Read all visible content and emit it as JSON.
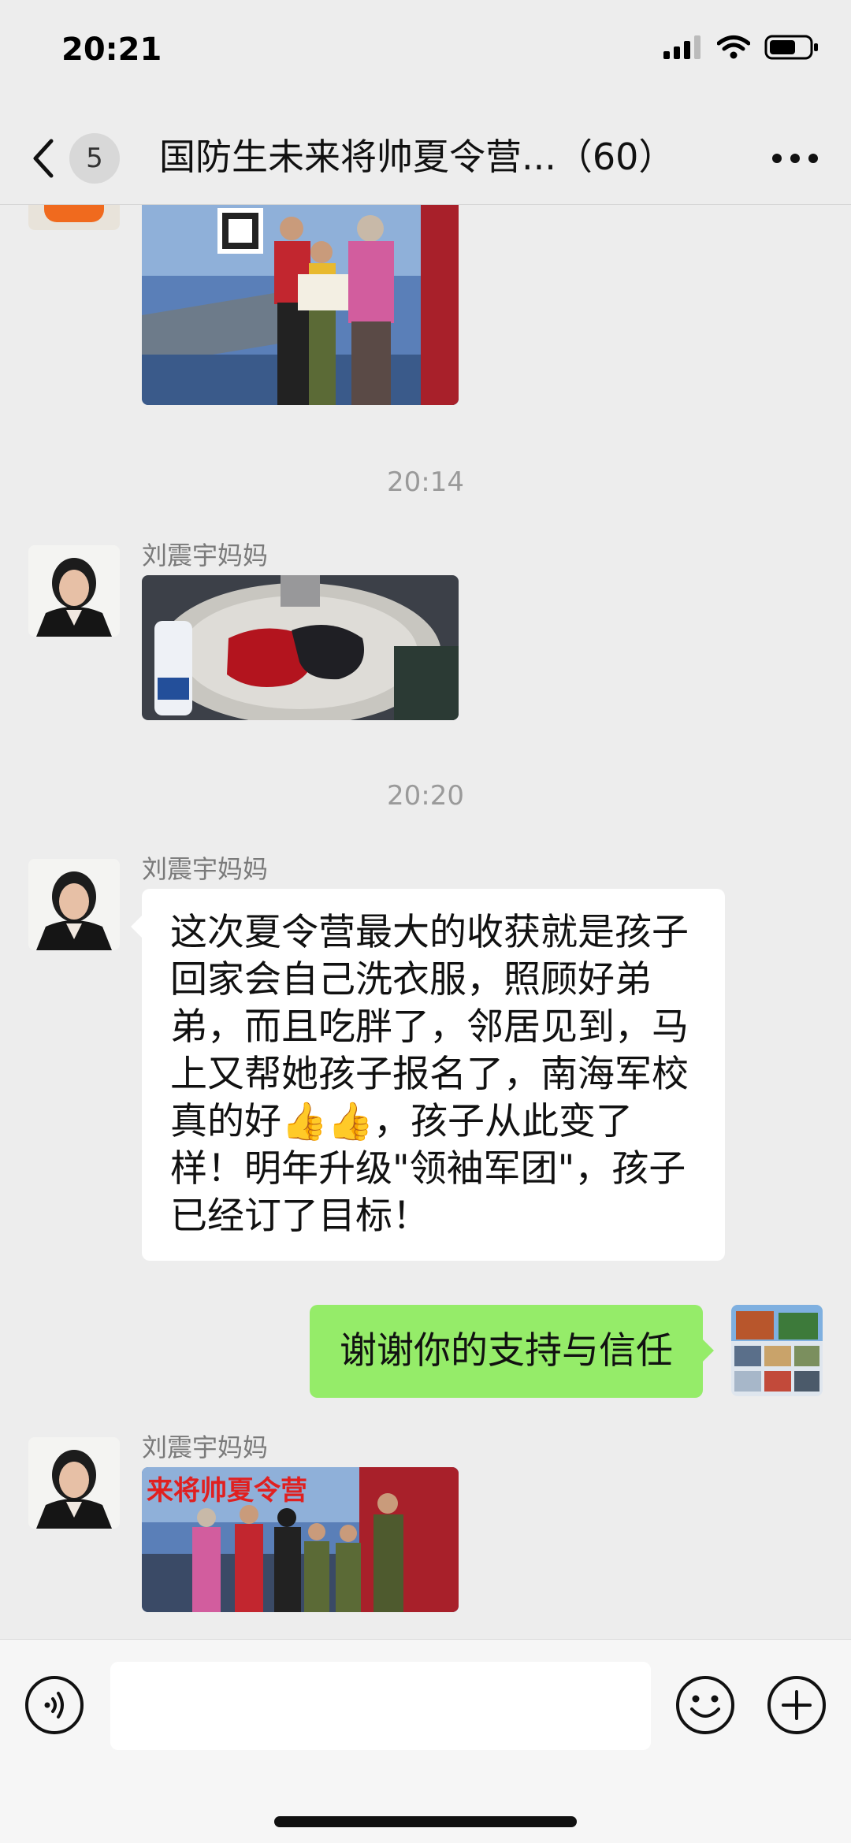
{
  "status_bar": {
    "time": "20:21"
  },
  "header": {
    "unread_count": "5",
    "title": "国防生未来将帅夏令营...（60）"
  },
  "messages": {
    "timestamp_1": "20:14",
    "sender_1": "刘震宇妈妈",
    "timestamp_2": "20:20",
    "sender_2": "刘震宇妈妈",
    "text_message": "这次夏令营最大的收获就是孩子回家会自己洗衣服，照顾好弟弟，而且吃胖了，邻居见到，马上又帮她孩子报名了，南海军校真的好👍👍，孩子从此变了样！明年升级\"领袖军团\"，孩子已经订了目标！",
    "reply": "谢谢你的支持与信任",
    "sender_3": "刘震宇妈妈",
    "banner_text": "来将帅夏令营"
  },
  "icons": [
    "back-icon",
    "more-icon",
    "voice-icon",
    "emoji-icon",
    "plus-icon",
    "signal-icon",
    "wifi-icon",
    "battery-icon"
  ],
  "colors": {
    "outgoing_bubble": "#95ec69",
    "incoming_bubble": "#ffffff",
    "background": "#ededed"
  }
}
